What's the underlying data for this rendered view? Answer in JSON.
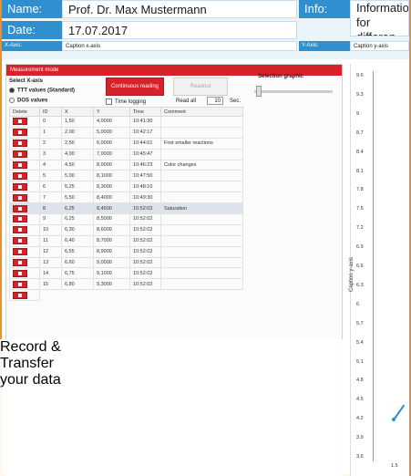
{
  "header": {
    "name_label": "Name:",
    "name_value": "Prof. Dr. Max Mustermann",
    "info_label": "Info:",
    "info_value_1": "Information",
    "info_value_2": "for differen",
    "date_label": "Date:",
    "date_value": "17.07.2017",
    "xaxis_label": "X-Axis:",
    "xaxis_value": "Caption x-axis",
    "yaxis_label": "Y-Axis:",
    "yaxis_value": "Caption y-axis"
  },
  "panel": {
    "title": "Measurement mode",
    "select_xaxis": "Select X-axis",
    "radio_ttt": "TTT values (Standard)",
    "radio_dos": "DOS values",
    "continuous_btn": "Continuous reading",
    "readout_btn": "Readout",
    "selection_graphic": "Selection graphic",
    "time_logging": "Time logging",
    "read_all": "Read all",
    "interval_value": "10",
    "interval_unit": "Sec.",
    "columns": [
      "Delete",
      "ID",
      "X",
      "Y",
      "Time",
      "Comment"
    ],
    "rows": [
      {
        "id": "0",
        "x": "1,50",
        "y": "4,0000",
        "time": "10:41:30",
        "comment": ""
      },
      {
        "id": "1",
        "x": "2,00",
        "y": "5,0000",
        "time": "10:42:17",
        "comment": ""
      },
      {
        "id": "2",
        "x": "2,50",
        "y": "6,0000",
        "time": "10:44:01",
        "comment": "First smaller reactions"
      },
      {
        "id": "3",
        "x": "4,00",
        "y": "7,0000",
        "time": "10:45:47",
        "comment": ""
      },
      {
        "id": "4",
        "x": "4,50",
        "y": "8,0000",
        "time": "10:46:23",
        "comment": "Color changes"
      },
      {
        "id": "5",
        "x": "5,00",
        "y": "8,1000",
        "time": "10:47:50",
        "comment": ""
      },
      {
        "id": "6",
        "x": "5,25",
        "y": "8,3000",
        "time": "10:48:10",
        "comment": ""
      },
      {
        "id": "7",
        "x": "5,50",
        "y": "8,4000",
        "time": "10:49:30",
        "comment": ""
      },
      {
        "id": "8",
        "x": "6,25",
        "y": "8,4500",
        "time": "10:52:02",
        "comment": "Saturation"
      },
      {
        "id": "9",
        "x": "6,25",
        "y": "8,5000",
        "time": "10:52:02",
        "comment": ""
      },
      {
        "id": "10",
        "x": "6,30",
        "y": "8,6000",
        "time": "10:52:02",
        "comment": ""
      },
      {
        "id": "11",
        "x": "6,40",
        "y": "8,7000",
        "time": "10:52:02",
        "comment": ""
      },
      {
        "id": "12",
        "x": "6,55",
        "y": "8,9000",
        "time": "10:52:02",
        "comment": ""
      },
      {
        "id": "13",
        "x": "6,60",
        "y": "9,0000",
        "time": "10:52:02",
        "comment": ""
      },
      {
        "id": "14",
        "x": "6,75",
        "y": "9,1000",
        "time": "10:52:02",
        "comment": ""
      },
      {
        "id": "15",
        "x": "6,80",
        "y": "9,3000",
        "time": "10:52:02",
        "comment": ""
      }
    ]
  },
  "chart": {
    "ylabel": "Caption y-axis",
    "yticks": [
      "9.6",
      "9.3",
      "9",
      "8.7",
      "8.4",
      "8.1",
      "7.8",
      "7.5",
      "7.2",
      "6.9",
      "6.6",
      "6.3",
      "6",
      "5.7",
      "5.4",
      "5.1",
      "4.8",
      "4.5",
      "4.2",
      "3.9",
      "3.6"
    ],
    "xtick": "1.5"
  },
  "overlay": {
    "line1": "Record &",
    "line2": "Transfer",
    "line3": "your data"
  },
  "colors": {
    "accent": "#2f8fcf",
    "alert": "#d7222a",
    "frame": "#e8902f"
  }
}
